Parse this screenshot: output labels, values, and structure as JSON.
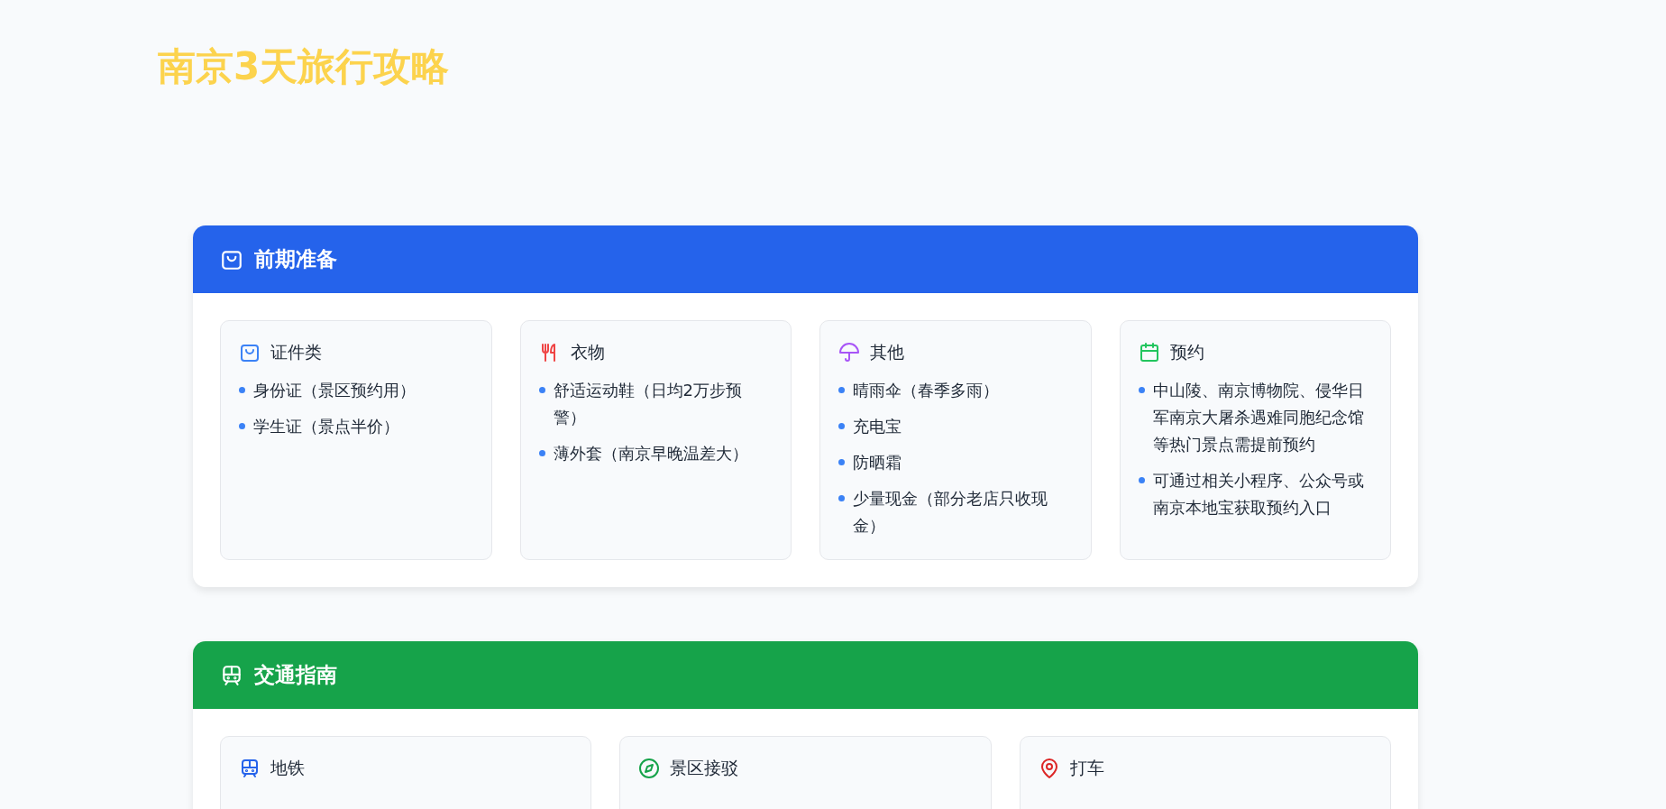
{
  "title": "南京3天旅行攻略",
  "sections": [
    {
      "title": "前期准备",
      "color": "#2563eb",
      "cards": [
        {
          "color": "#3b82f6",
          "title": "证件类",
          "items": [
            "身份证（景区预约用）",
            "学生证（景点半价）"
          ]
        },
        {
          "color": "#ef4444",
          "title": "衣物",
          "items": [
            "舒适运动鞋（日均2万步预警）",
            "薄外套（南京早晚温差大）"
          ]
        },
        {
          "color": "#a855f7",
          "title": "其他",
          "items": [
            "晴雨伞（春季多雨）",
            "充电宝",
            "防晒霜",
            "少量现金（部分老店只收现金）"
          ]
        },
        {
          "color": "#22c55e",
          "title": "预约",
          "items": [
            "中山陵、南京博物院、侵华日军南京大屠杀遇难同胞纪念馆等热门景点需提前预约",
            "可通过相关小程序、公众号或南京本地宝获取预约入口"
          ]
        }
      ]
    },
    {
      "title": "交通指南",
      "color": "#16a34a",
      "cards": [
        {
          "color": "#2563eb",
          "title": "地铁"
        },
        {
          "color": "#16a34a",
          "title": "景区接驳"
        },
        {
          "color": "#dc2626",
          "title": "打车"
        }
      ]
    }
  ]
}
